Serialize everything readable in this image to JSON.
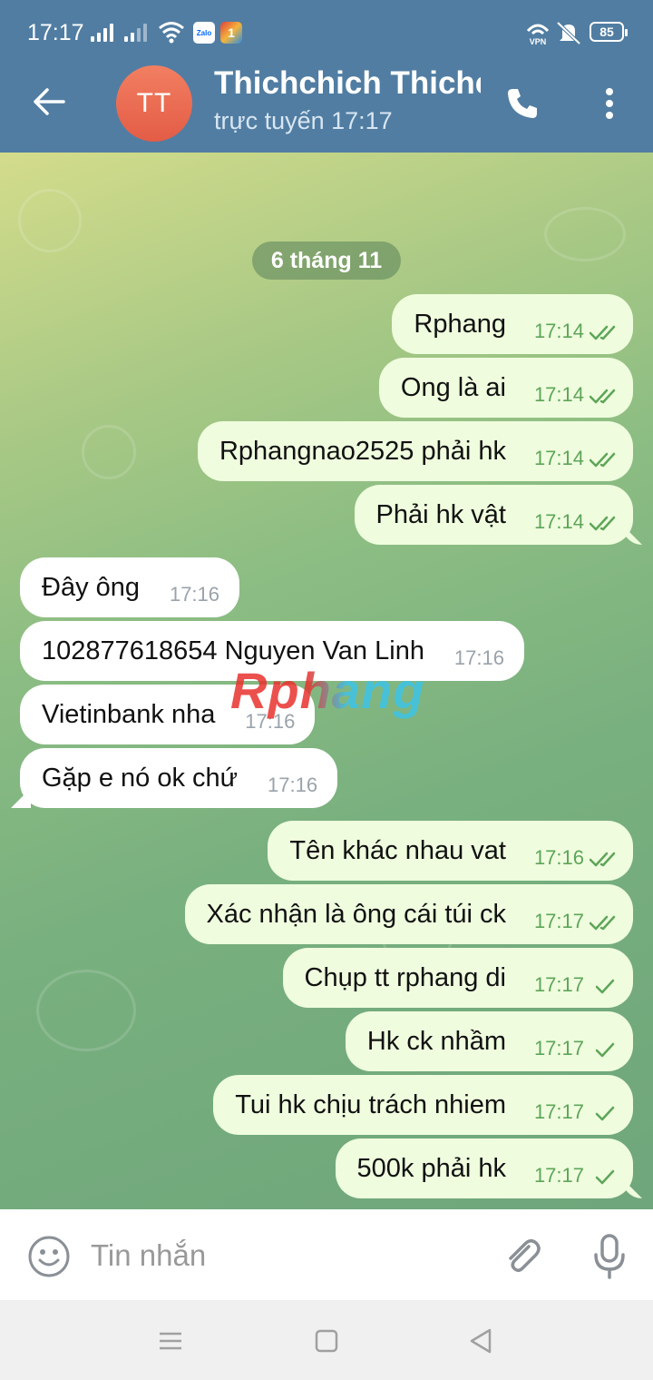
{
  "status_bar": {
    "time": "17:17",
    "battery": "85",
    "icons": [
      "signal-icon",
      "signal-icon",
      "wifi-icon",
      "zalo-app-icon",
      "app-one-icon",
      "vpn-icon",
      "mute-icon",
      "battery-icon"
    ],
    "zalo_label": "Zalo",
    "app_one_label": "1"
  },
  "header": {
    "avatar_initials": "TT",
    "title": "Thichchich Thichchich",
    "status": "trực tuyến 17:17",
    "colors": {
      "bar": "#517da2",
      "avatar": "#e8664f"
    }
  },
  "chat": {
    "date_chip": "6 tháng 11",
    "watermark": "Rphang",
    "messages": [
      {
        "dir": "out",
        "text": "Rphang",
        "time": "17:14",
        "status": "read"
      },
      {
        "dir": "out",
        "text": "Ong là ai",
        "time": "17:14",
        "status": "read"
      },
      {
        "dir": "out",
        "text": "Rphangnao2525 phải hk",
        "time": "17:14",
        "status": "read"
      },
      {
        "dir": "out",
        "text": "Phải hk vật",
        "time": "17:14",
        "status": "read"
      },
      {
        "dir": "in",
        "text": "Đây ông",
        "time": "17:16"
      },
      {
        "dir": "in",
        "text": "102877618654 Nguyen Van Linh",
        "time": "17:16"
      },
      {
        "dir": "in",
        "text": "Vietinbank nha",
        "time": "17:16"
      },
      {
        "dir": "in",
        "text": "Gặp e nó ok chứ",
        "time": "17:16"
      },
      {
        "dir": "out",
        "text": "Tên khác nhau vat",
        "time": "17:16",
        "status": "read"
      },
      {
        "dir": "out",
        "text": "Xác nhận là ông cái túi ck",
        "time": "17:17",
        "status": "read"
      },
      {
        "dir": "out",
        "text": "Chụp tt rphang di",
        "time": "17:17",
        "status": "sent"
      },
      {
        "dir": "out",
        "text": "Hk ck nhầm",
        "time": "17:17",
        "status": "sent"
      },
      {
        "dir": "out",
        "text": "Tui hk chịu trách nhiem",
        "time": "17:17",
        "status": "sent"
      },
      {
        "dir": "out",
        "text": "500k phải hk",
        "time": "17:17",
        "status": "sent"
      }
    ],
    "colors": {
      "out_bubble": "#effdde",
      "in_bubble": "#ffffff",
      "check": "#5ea559"
    }
  },
  "composer": {
    "placeholder": "Tin nhắn",
    "icons": [
      "emoji-icon",
      "attach-icon",
      "mic-icon"
    ]
  },
  "nav_bar": {
    "icons": [
      "menu-icon",
      "home-icon",
      "back-triangle-icon"
    ]
  }
}
